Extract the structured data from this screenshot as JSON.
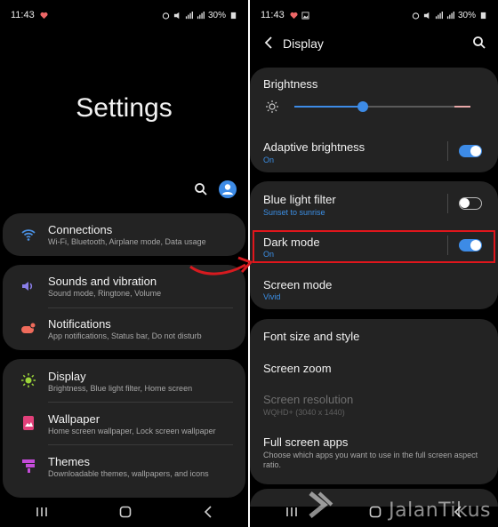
{
  "left": {
    "status": {
      "time": "11:43",
      "battery": "30%"
    },
    "title": "Settings",
    "groups": [
      {
        "items": [
          {
            "title": "Connections",
            "sub": "Wi-Fi, Bluetooth, Airplane mode, Data usage",
            "icon": "wifi-icon",
            "color": "#4a90e2"
          }
        ]
      },
      {
        "items": [
          {
            "title": "Sounds and vibration",
            "sub": "Sound mode, Ringtone, Volume",
            "icon": "speaker-icon",
            "color": "#8a7ee8"
          },
          {
            "title": "Notifications",
            "sub": "App notifications, Status bar, Do not disturb",
            "icon": "notification-icon",
            "color": "#ef6b5b"
          }
        ]
      },
      {
        "items": [
          {
            "title": "Display",
            "sub": "Brightness, Blue light filter, Home screen",
            "icon": "sun-icon",
            "color": "#9bd43a"
          },
          {
            "title": "Wallpaper",
            "sub": "Home screen wallpaper, Lock screen wallpaper",
            "icon": "wallpaper-icon",
            "color": "#e2407a"
          },
          {
            "title": "Themes",
            "sub": "Downloadable themes, wallpapers, and icons",
            "icon": "themes-icon",
            "color": "#c44bd8"
          }
        ]
      }
    ]
  },
  "right": {
    "status": {
      "time": "11:43",
      "battery": "30%"
    },
    "header": {
      "title": "Display"
    },
    "brightness": {
      "label": "Brightness",
      "level": 0.39
    },
    "adaptive": {
      "title": "Adaptive brightness",
      "sub": "On",
      "on": true
    },
    "blue_light": {
      "title": "Blue light filter",
      "sub": "Sunset to sunrise",
      "on": false
    },
    "dark_mode": {
      "title": "Dark mode",
      "sub": "On",
      "on": true
    },
    "screen_mode": {
      "title": "Screen mode",
      "sub": "Vivid"
    },
    "font": {
      "title": "Font size and style"
    },
    "zoom": {
      "title": "Screen zoom"
    },
    "resolution": {
      "title": "Screen resolution",
      "sub": "WQHD+ (3040 x 1440)"
    },
    "full_screen": {
      "title": "Full screen apps",
      "sub": "Choose which apps you want to use in the full screen aspect ratio."
    }
  },
  "watermark": "JalanTikus",
  "colors": {
    "accent": "#3d8be6",
    "highlight": "#e0161c",
    "arrow": "#d61a1f"
  }
}
